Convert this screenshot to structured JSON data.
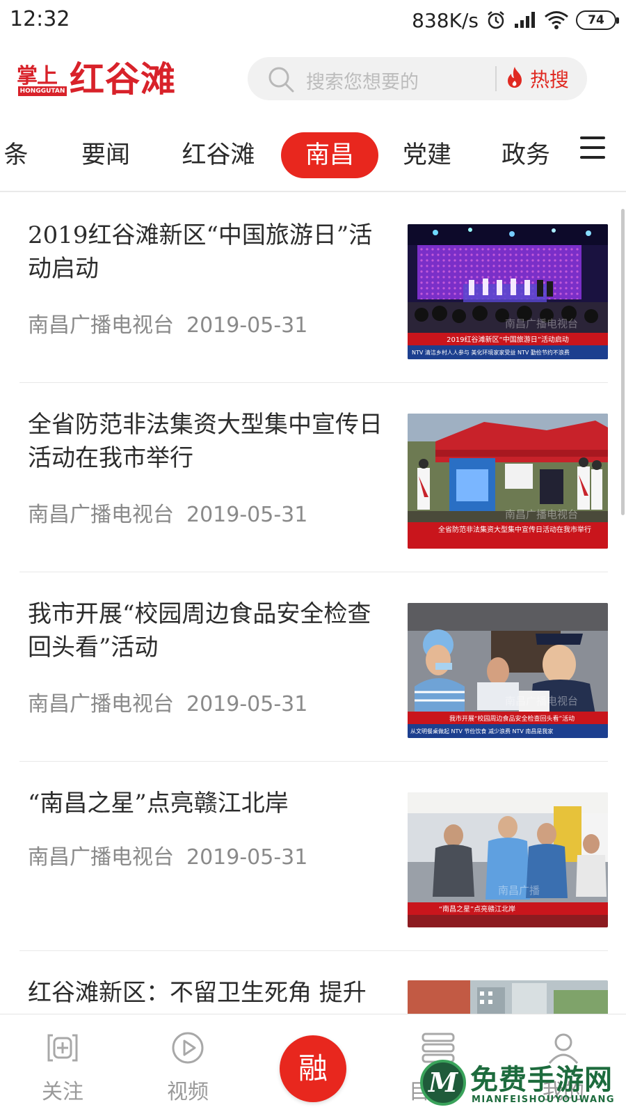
{
  "status_bar": {
    "time": "12:32",
    "net_speed": "838K/s",
    "battery": "74",
    "icons": [
      "alarm-icon",
      "signal-icon",
      "wifi-icon",
      "battery-icon"
    ]
  },
  "header": {
    "logo_top": "掌上",
    "logo_main": "红谷滩",
    "logo_sub": "HONGGUTAN",
    "search_placeholder": "搜索您想要的",
    "hot_search_label": "热搜",
    "accent_color": "#e8271e"
  },
  "tabs": {
    "items": [
      "条",
      "要闻",
      "红谷滩",
      "南昌",
      "党建",
      "政务"
    ],
    "active": "南昌"
  },
  "news": [
    {
      "title": "2019红谷滩新区“中国旅游日”活动启动",
      "source": "南昌广播电视台",
      "date": "2019-05-31",
      "thumb_caption": "2019红谷滩新区“中国旅游日”活动启动",
      "thumb_ticker": "NTV 清洁乡村人人参与 美化环境家家受益 NTV 勤俭节约不浪费",
      "thumb_watermark": "南昌广播电视台"
    },
    {
      "title": "全省防范非法集资大型集中宣传日活动在我市举行",
      "source": "南昌广播电视台",
      "date": "2019-05-31",
      "thumb_caption": "全省防范非法集资大型集中宣传日活动在我市举行",
      "thumb_ticker": "",
      "thumb_watermark": "南昌广播电视台"
    },
    {
      "title": "我市开展“校园周边食品安全检查回头看”活动",
      "source": "南昌广播电视台",
      "date": "2019-05-31",
      "thumb_caption": "我市开展“校园周边食品安全检查回头看”活动",
      "thumb_ticker": "从文明餐桌做起 NTV 节俭饮食 减少浪费 NTV 南昌是我家",
      "thumb_watermark": "南昌广播电视台"
    },
    {
      "title": "“南昌之星”点亮赣江北岸",
      "source": "南昌广播电视台",
      "date": "2019-05-31",
      "thumb_caption": "“南昌之星”点亮赣江北岸",
      "thumb_ticker": "",
      "thumb_watermark": "南昌广播"
    },
    {
      "title": "红谷滩新区：不留卫生死角 提升",
      "source": "",
      "date": "",
      "thumb_caption": "",
      "thumb_ticker": "",
      "thumb_watermark": ""
    }
  ],
  "bottom_nav": {
    "follow": "关注",
    "video": "视频",
    "center": "融",
    "menu_icon_label": "目",
    "mine": "我的"
  },
  "watermark": {
    "badge": "M",
    "text": "免费手游网",
    "sub": "MIANFEISHOUYOUWANG"
  }
}
